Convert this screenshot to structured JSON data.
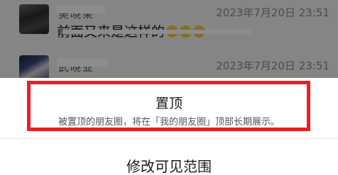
{
  "comments": [
    {
      "nickname": "吴晓莱",
      "time": "2023年7月20日 23:51",
      "text": "前面又来是这样的"
    },
    {
      "nickname": "武晓亚",
      "time": "2023年7月20日 23:51"
    }
  ],
  "action_sheet": {
    "pin": {
      "title": "置顶",
      "description": "被置顶的朋友圈，将在「我的朋友圈」顶部长期展示。"
    },
    "visibility": {
      "label": "修改可见范围"
    }
  },
  "colors": {
    "highlight": "#ee1c24",
    "overlay": "rgba(0,0,0,0.45)"
  }
}
